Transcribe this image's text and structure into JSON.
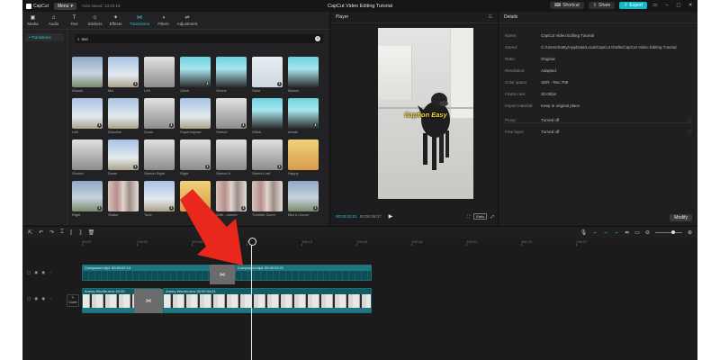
{
  "app": {
    "logo_text": "CapCut",
    "menu_label": "Menu",
    "autosave": "Auto saved: 13:20:18",
    "title": "CapCut Video Editing Tutorial",
    "shortcut_label": "Shortcut",
    "share_label": "Share",
    "export_label": "Export"
  },
  "media_tabs": [
    {
      "label": "Media",
      "icon": "media-icon",
      "glyph": "▣"
    },
    {
      "label": "Audio",
      "icon": "audio-icon",
      "glyph": "♫"
    },
    {
      "label": "Text",
      "icon": "text-icon",
      "glyph": "T"
    },
    {
      "label": "Stickers",
      "icon": "sticker-icon",
      "glyph": "☺"
    },
    {
      "label": "Effects",
      "icon": "effects-icon",
      "glyph": "✦"
    },
    {
      "label": "Transitions",
      "icon": "transitions-icon",
      "glyph": "⋈"
    },
    {
      "label": "Filters",
      "icon": "filters-icon",
      "glyph": "◑"
    },
    {
      "label": "Adjustment",
      "icon": "adjustment-icon",
      "glyph": "⇌"
    }
  ],
  "sidebar": {
    "item": "• Transitions"
  },
  "search": {
    "value": "text"
  },
  "transitions": [
    "Woosh",
    "Mix",
    "Left",
    "Glitch",
    "Strobe",
    "Slant",
    "Blanch",
    "Left",
    "Dissolve",
    "Down",
    "Superimpose",
    "Stretch",
    "Glitch",
    "Inhale",
    "Shutter",
    "Down",
    "Stretch Right",
    "Right",
    "Stretch II",
    "Stretch Left",
    "Happy",
    "Right",
    "Shake",
    "Tone",
    "",
    "Glith...mories",
    "Tremble Zoom",
    "Blur In Zoom"
  ],
  "player": {
    "header": "Player",
    "caption": "Caption Easy",
    "current_time": "00:00:03:01",
    "total_time": "00:00:05:07",
    "ratio_label": "Ratio"
  },
  "details": {
    "header": "Details",
    "rows": [
      {
        "k": "Name:",
        "v": "CapCut Video Editing Tutorial"
      },
      {
        "k": "Saved:",
        "v": "C:/Users/matty/AppData/Local/CapCut Drafts/CapCut Video Editing Tutorial"
      },
      {
        "k": "Ratio:",
        "v": "Original"
      },
      {
        "k": "Resolution:",
        "v": "Adapted"
      },
      {
        "k": "Color space:",
        "v": "SDR - Rec.709"
      },
      {
        "k": "Frame rate:",
        "v": "30.00fps"
      },
      {
        "k": "Import material:",
        "v": "Keep in original place"
      }
    ],
    "rows2": [
      {
        "k": "Proxy:",
        "v": "Turned off"
      },
      {
        "k": "Free layer:",
        "v": "Turned off"
      }
    ],
    "modify_label": "Modify"
  },
  "ruler": [
    "00:00",
    "100:03",
    "100:06",
    "00:09",
    "100:12",
    "100:15",
    "100:18",
    "100:21",
    "100:24",
    "100:27"
  ],
  "clips": {
    "compound1": "Compound clip1   00:00:02:14",
    "compound2": "Compound clip1   00:00:02:21",
    "main1": "Ammy Woofin.mov   00:00",
    "main2": "Ammy Woofin.mov   00:00:04:01",
    "cover": "Cover"
  }
}
